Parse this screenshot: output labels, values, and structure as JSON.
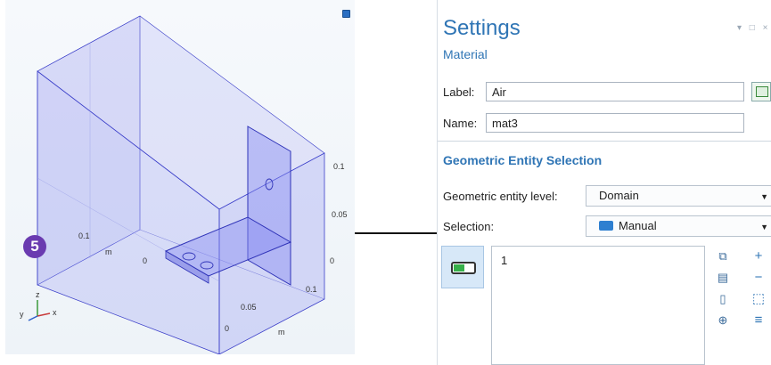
{
  "viewport": {
    "step_badge": "5",
    "view_icon": "camera-icon",
    "ticks": {
      "y_val_1": "0.1",
      "y_unit": "m",
      "y_zero": "0",
      "x_val_1": "0.05",
      "x_val_2": "0.1",
      "x_zero": "0",
      "x_unit": "m",
      "z_val_1": "0.1",
      "z_val_2": "0.05",
      "z_zero": "0"
    },
    "triad": {
      "x": "x",
      "y": "y",
      "z": "z"
    },
    "colors": {
      "domain_fill": "#7b7ff0",
      "domain_edge": "#3b3fc9",
      "badge": "#6a3bb0"
    }
  },
  "settings": {
    "title": "Settings",
    "subtitle": "Material",
    "window_controls": "▾ □ ×",
    "label_field": {
      "label": "Label:",
      "value": "Air"
    },
    "name_field": {
      "label": "Name:",
      "value": "mat3"
    },
    "note_icon": "comment-icon",
    "section": "Geometric Entity Selection",
    "entity_level": {
      "label": "Geometric entity level:",
      "value": "Domain"
    },
    "selection": {
      "label": "Selection:",
      "value": "Manual"
    },
    "selection_list": [
      "1"
    ],
    "side_icons": [
      "paste-selection-icon",
      "copy-selection-icon",
      "clear-selection-icon",
      "zoom-to-selection-icon"
    ],
    "side_icons_right": [
      "add-icon",
      "remove-icon",
      "select-in-graphics-icon",
      "show-icon"
    ],
    "accent": "#2f75b5"
  }
}
